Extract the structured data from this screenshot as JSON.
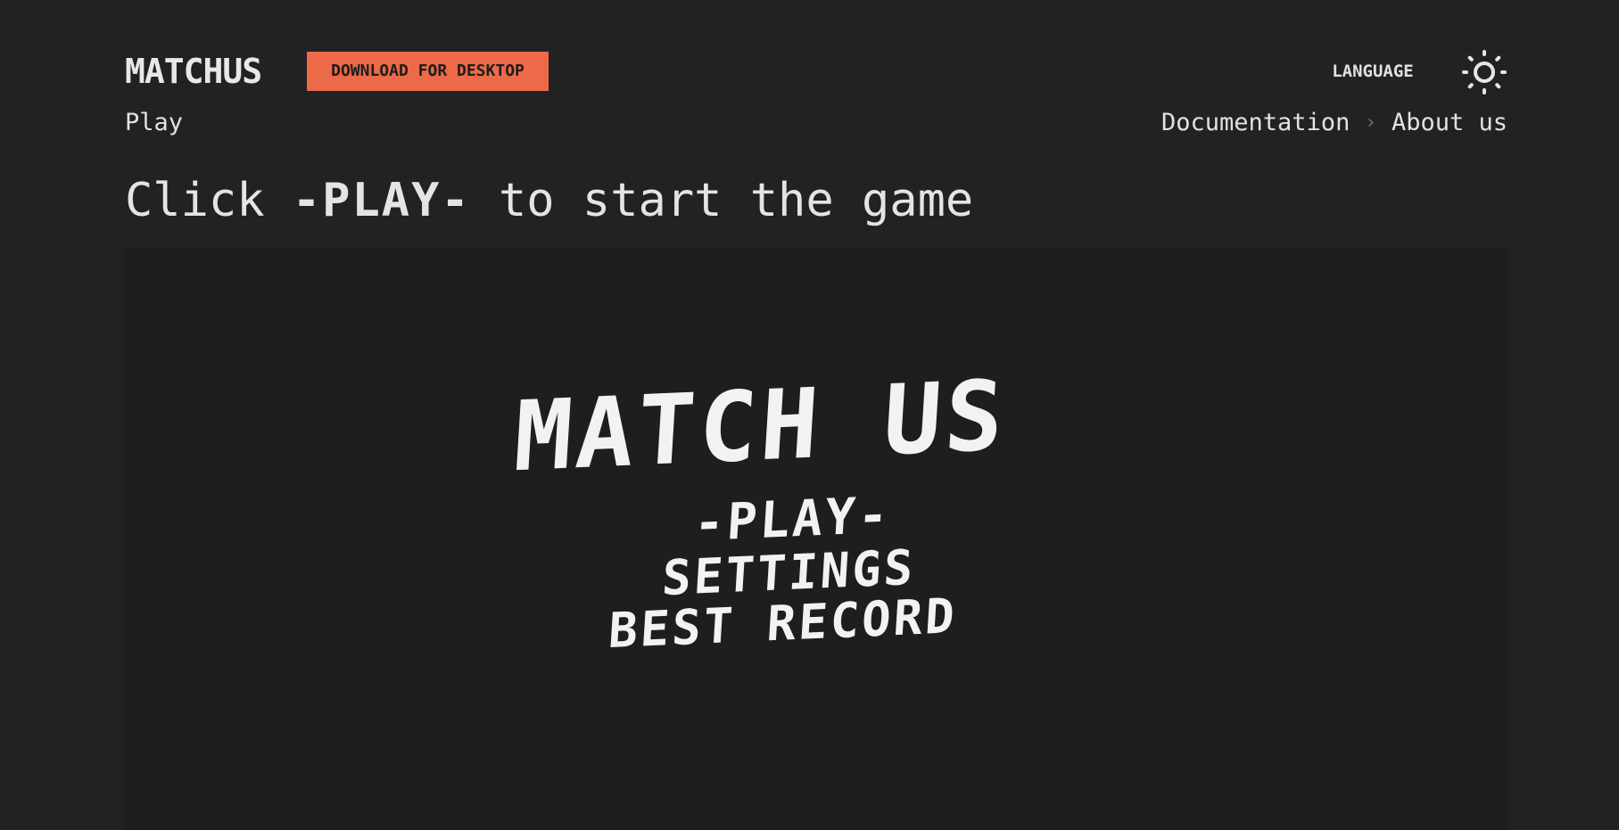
{
  "header": {
    "brand": "MATCHUS",
    "download_label": "DOWNLOAD FOR DESKTOP",
    "language_label": "LANGUAGE",
    "theme_icon": "sun-icon"
  },
  "nav": {
    "play": "Play",
    "documentation": "Documentation",
    "separator": "›",
    "about": "About us"
  },
  "instruction": {
    "prefix": "Click ",
    "highlight": "-PLAY-",
    "suffix": " to start the game"
  },
  "game": {
    "title": "MATCH US",
    "menu": {
      "play": "-PLAY-",
      "settings": "SETTINGS",
      "best_record": "BEST RECORD"
    }
  },
  "colors": {
    "background": "#222222",
    "canvas": "#1e1e1e",
    "accent": "#ed6a48",
    "text": "#e4e4e4"
  }
}
